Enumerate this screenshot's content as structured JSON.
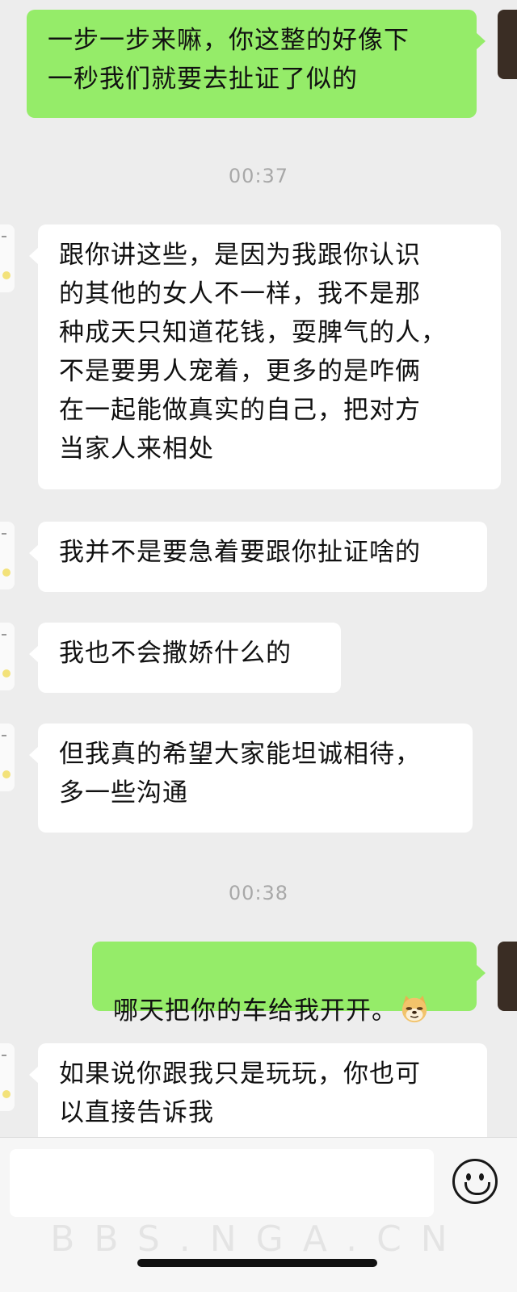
{
  "conversation": {
    "m1": "一步一步来嘛，你这整的好像下\n一秒我们就要去扯证了似的",
    "t1": "00:37",
    "m2": "跟你讲这些，是因为我跟你认识\n的其他的女人不一样，我不是那\n种成天只知道花钱，耍脾气的人，\n不是要男人宠着，更多的是咋俩\n在一起能做真实的自己，把对方\n当家人来相处",
    "m3": "我并不是要急着要跟你扯证啥的",
    "m4": "我也不会撒娇什么的",
    "m5": "但我真的希望大家能坦诚相待，\n多一些沟通",
    "t2": "00:38",
    "m6": "哪天把你的车给我开开。",
    "m6_emoji": "doge-emoji",
    "m7": "如果说你跟我只是玩玩，你也可\n以直接告诉我"
  },
  "input_bar": {
    "emoji_icon": "smiley-face-icon",
    "watermark": "BBS.NGA.CN"
  },
  "colors": {
    "background": "#ededed",
    "incoming_bubble": "#ffffff",
    "outgoing_bubble": "#95ec69",
    "timestamp": "#a8a8a8"
  }
}
